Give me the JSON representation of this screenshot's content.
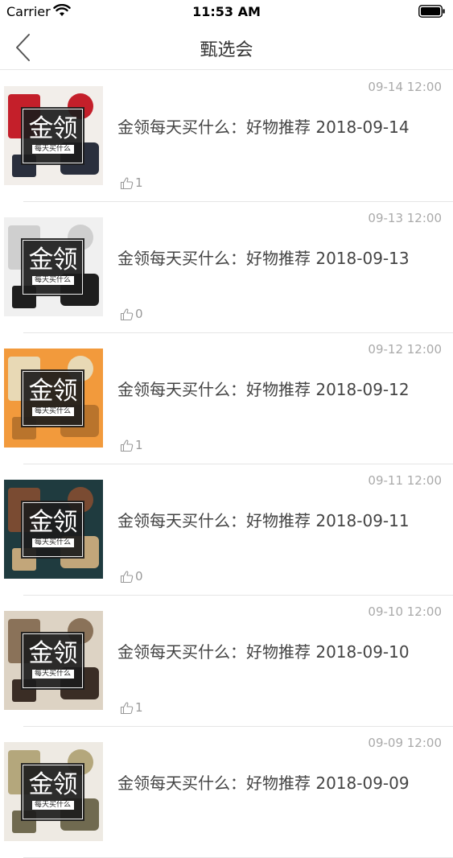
{
  "status_bar": {
    "carrier": "Carrier",
    "time": "11:53 AM"
  },
  "nav": {
    "title": "甄选会",
    "back_icon": "chevron-left-icon"
  },
  "list": {
    "items": [
      {
        "date": "09-14 12:00",
        "title": "金领每天买什么：好物推荐  2018-09-14",
        "likes": "1",
        "badge_big": "金领",
        "badge_small": "每天买什么",
        "colors": [
          "#f2eeea",
          "#c41f2a",
          "#2a2f3d"
        ]
      },
      {
        "date": "09-13 12:00",
        "title": "金领每天买什么：好物推荐  2018-09-13",
        "likes": "0",
        "badge_big": "金领",
        "badge_small": "每天买什么",
        "colors": [
          "#f0f0f0",
          "#cfcfcf",
          "#1e1e1e"
        ]
      },
      {
        "date": "09-12 12:00",
        "title": "金领每天买什么：好物推荐  2018-09-12",
        "likes": "1",
        "badge_big": "金领",
        "badge_small": "每天买什么",
        "colors": [
          "#f29a3c",
          "#e8d9b5",
          "#b9742c"
        ]
      },
      {
        "date": "09-11 12:00",
        "title": "金领每天买什么：好物推荐  2018-09-11",
        "likes": "0",
        "badge_big": "金领",
        "badge_small": "每天买什么",
        "colors": [
          "#1f3b3f",
          "#7a4b32",
          "#c2a67a"
        ]
      },
      {
        "date": "09-10 12:00",
        "title": "金领每天买什么：好物推荐  2018-09-10",
        "likes": "1",
        "badge_big": "金领",
        "badge_small": "每天买什么",
        "colors": [
          "#ddd3c4",
          "#8a7259",
          "#3a2d25"
        ]
      },
      {
        "date": "09-09 12:00",
        "title": "金领每天买什么：好物推荐  2018-09-09",
        "likes": "",
        "badge_big": "金领",
        "badge_small": "每天买什么",
        "colors": [
          "#eeeae3",
          "#b4a77c",
          "#706a50"
        ]
      }
    ],
    "like_icon": "thumbs-up-icon"
  }
}
